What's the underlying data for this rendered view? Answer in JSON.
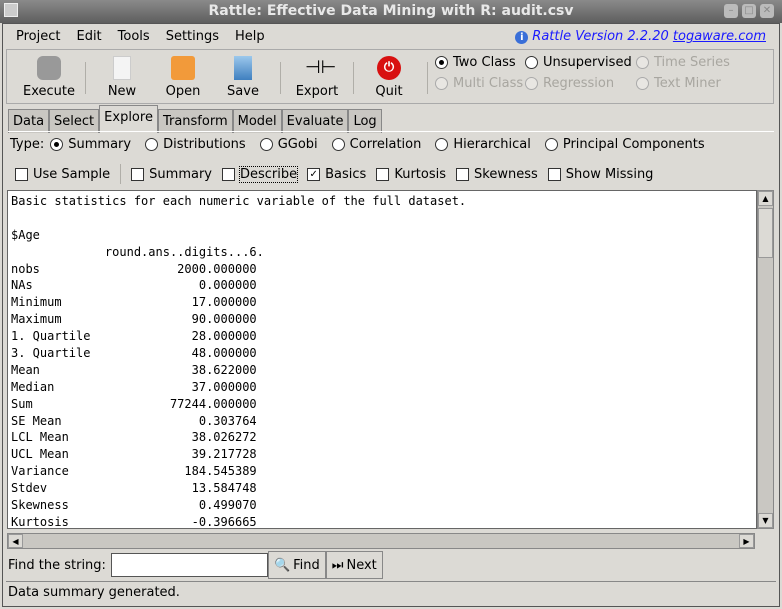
{
  "window": {
    "title": "Rattle: Effective Data Mining with R: audit.csv"
  },
  "menu": [
    "Project",
    "Edit",
    "Tools",
    "Settings",
    "Help"
  ],
  "version": {
    "text": "Rattle Version 2.2.20",
    "link": "togaware.com"
  },
  "toolbar": {
    "execute": "Execute",
    "new": "New",
    "open": "Open",
    "save": "Save",
    "export": "Export",
    "quit": "Quit"
  },
  "mode": [
    {
      "label": "Two Class",
      "selected": true,
      "enabled": true
    },
    {
      "label": "Unsupervised",
      "selected": false,
      "enabled": true
    },
    {
      "label": "Time Series",
      "selected": false,
      "enabled": false
    },
    {
      "label": "Multi Class",
      "selected": false,
      "enabled": false
    },
    {
      "label": "Regression",
      "selected": false,
      "enabled": false
    },
    {
      "label": "Text Miner",
      "selected": false,
      "enabled": false
    }
  ],
  "tabs": [
    "Data",
    "Select",
    "Explore",
    "Transform",
    "Model",
    "Evaluate",
    "Log"
  ],
  "active_tab": "Explore",
  "type": {
    "label": "Type:",
    "options": [
      "Summary",
      "Distributions",
      "GGobi",
      "Correlation",
      "Hierarchical",
      "Principal Components"
    ],
    "selected": "Summary"
  },
  "checks": [
    {
      "label": "Use Sample",
      "checked": false
    },
    {
      "label": "Summary",
      "checked": false
    },
    {
      "label": "Describe",
      "checked": false
    },
    {
      "label": "Basics",
      "checked": true
    },
    {
      "label": "Kurtosis",
      "checked": false
    },
    {
      "label": "Skewness",
      "checked": false
    },
    {
      "label": "Show Missing",
      "checked": false
    }
  ],
  "output": [
    "Basic statistics for each numeric variable of the full dataset.",
    "",
    "$Age",
    "             round.ans..digits...6.",
    "nobs                   2000.000000",
    "NAs                       0.000000",
    "Minimum                  17.000000",
    "Maximum                  90.000000",
    "1. Quartile              28.000000",
    "3. Quartile              48.000000",
    "Mean                     38.622000",
    "Median                   37.000000",
    "Sum                   77244.000000",
    "SE Mean                   0.303764",
    "LCL Mean                 38.026272",
    "UCL Mean                 39.217728",
    "Variance                184.545389",
    "Stdev                    13.584748",
    "Skewness                  0.499070",
    "Kurtosis                 -0.396665"
  ],
  "find": {
    "label": "Find the string:",
    "value": "",
    "find_button": "Find",
    "next_button": "Next"
  },
  "status": "Data summary generated."
}
